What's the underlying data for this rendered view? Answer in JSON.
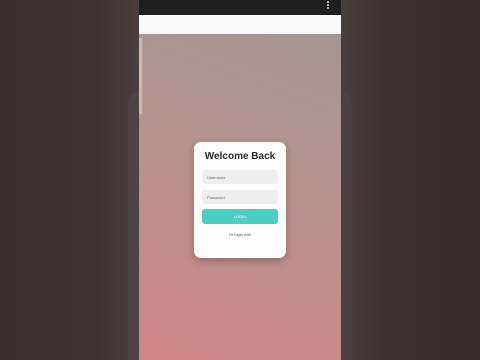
{
  "login": {
    "title": "Welcome Back",
    "username_placeholder": "Username",
    "password_placeholder": "Password",
    "login_label": "LOGIN",
    "social_text": "Or login with"
  },
  "colors": {
    "accent": "#4ecdc4",
    "background_top": "#a39692",
    "background_bottom": "#d08684",
    "card": "#fcfcfc"
  },
  "icons": {
    "menu": "more-vert-icon"
  }
}
